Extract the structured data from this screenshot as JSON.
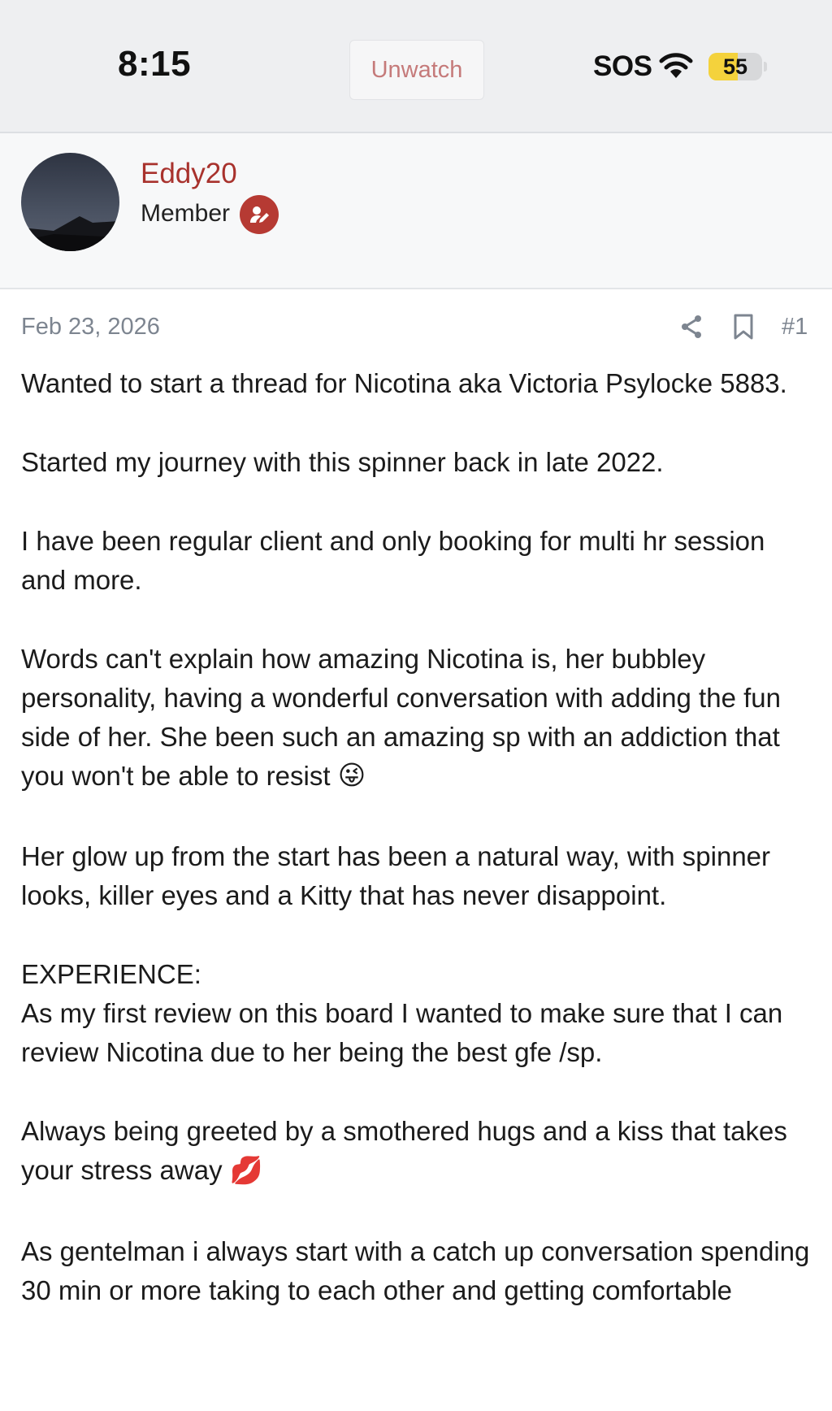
{
  "status_bar": {
    "time": "8:15",
    "unwatch_label": "Unwatch",
    "sos_label": "SOS",
    "battery_level": "55",
    "battery_fraction": 0.55,
    "wifi_icon": "wifi-icon"
  },
  "author": {
    "username": "Eddy20",
    "role": "Member",
    "role_icon": "pen-badge-icon",
    "username_color": "#a8322d"
  },
  "post": {
    "date": "Feb 23, 2026",
    "number": "#1",
    "share_icon": "share-icon",
    "bookmark_icon": "bookmark-icon",
    "paragraphs": {
      "p1": "Wanted to start a thread for Nicotina aka Victoria Psylocke 5883.",
      "p2": "Started my journey with this spinner back in late 2022.",
      "p3": "I have been regular client and only booking for multi hr session and more.",
      "p4": "Words can't explain how amazing Nicotina is, her bubbley personality, having a wonderful conversation with adding the fun side of her. She been such an amazing sp with an addiction that you won't be able to resist",
      "p4_emoji": "😜",
      "p5": "Her glow up from the start has been a natural way, with spinner looks, killer eyes and a Kitty that has never disappoint.",
      "p6_heading": "EXPERIENCE:",
      "p6": "As my first review on this board I wanted to make sure that I can review Nicotina due to her being the best gfe /sp.",
      "p7": "Always being greeted by a smothered hugs and a kiss that takes your stress away",
      "p7_emoji": "💋",
      "p8": "As gentelman i always start with a catch up conversation spending 30 min or more taking to each other and getting comfortable"
    }
  }
}
